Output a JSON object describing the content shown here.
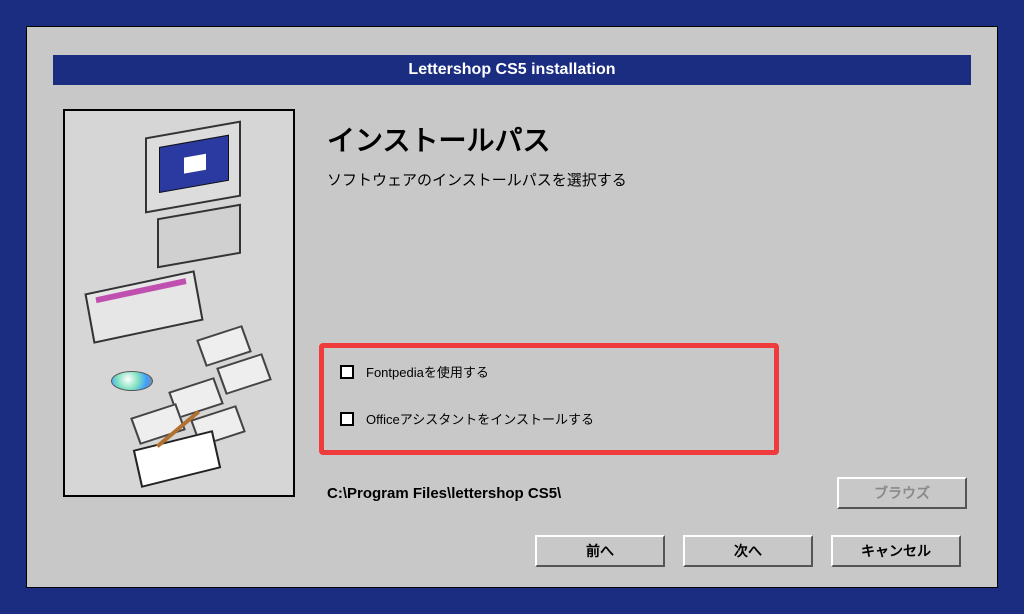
{
  "titlebar": {
    "text": "Lettershop CS5 installation"
  },
  "content": {
    "heading": "インストールパス",
    "subheading": "ソフトウェアのインストールパスを選択する"
  },
  "options": {
    "fontpedia_label": "Fontpediaを使用する",
    "office_assistant_label": "Officeアシスタントをインストールする"
  },
  "path": {
    "value": "C:\\Program Files\\lettershop CS5\\"
  },
  "buttons": {
    "browse": "ブラウズ",
    "back": "前へ",
    "next": "次へ",
    "cancel": "キャンセル"
  }
}
